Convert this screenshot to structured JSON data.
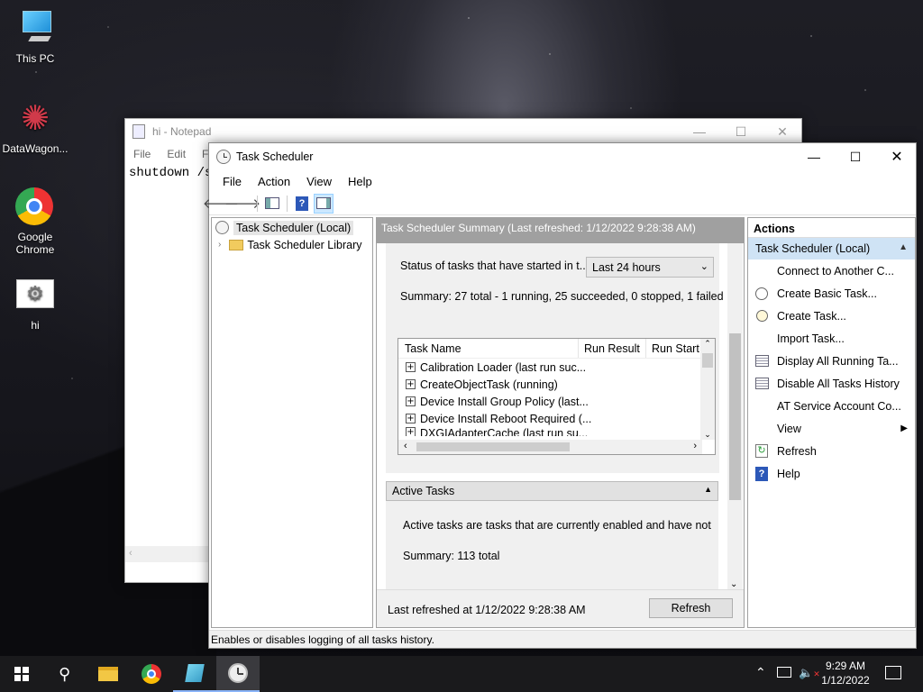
{
  "desktop": {
    "icons": [
      {
        "label": "This PC"
      },
      {
        "label": "DataWagon..."
      },
      {
        "label": "Google Chrome"
      },
      {
        "label": "hi"
      }
    ]
  },
  "notepad": {
    "title": "hi - Notepad",
    "menus": [
      "File",
      "Edit",
      "Forr"
    ],
    "content": "shutdown /s"
  },
  "ts": {
    "title": "Task Scheduler",
    "menu": [
      "File",
      "Action",
      "View",
      "Help"
    ],
    "tree": {
      "root": "Task Scheduler (Local)",
      "child": "Task Scheduler Library"
    },
    "summary_header": "Task Scheduler Summary (Last refreshed: 1/12/2022 9:28:38 AM)",
    "status_label": "Status of tasks that have started in t...",
    "status_select": "Last 24 hours",
    "summary_text": "Summary: 27 total - 1 running, 25 succeeded, 0 stopped, 1 failed",
    "columns": [
      "Task Name",
      "Run Result",
      "Run Start"
    ],
    "tasks": [
      "Calibration Loader (last run suc...",
      "CreateObjectTask (running)",
      "Device Install Group Policy (last...",
      "Device Install Reboot Required (...",
      "DXGIAdapterCache (last run su..."
    ],
    "active_header": "Active Tasks",
    "active_desc": "Active tasks are tasks that are currently enabled and have not",
    "active_summary": "Summary: 113 total",
    "last_refreshed": "Last refreshed at 1/12/2022 9:28:38 AM",
    "refresh_button": "Refresh",
    "actions_header": "Actions",
    "actions_section": "Task Scheduler (Local)",
    "actions": [
      "Connect to Another C...",
      "Create Basic Task...",
      "Create Task...",
      "Import Task...",
      "Display All Running Ta...",
      "Disable All Tasks History",
      "AT Service Account Co...",
      "View",
      "Refresh",
      "Help"
    ],
    "status_bar": "Enables or disables logging of all tasks history."
  },
  "taskbar": {
    "time": "9:29 AM",
    "date": "1/12/2022"
  },
  "colors": {
    "accent": "#cce8ff",
    "header_gray": "#a0a0a0",
    "taskbar": "#1a1a1c"
  }
}
